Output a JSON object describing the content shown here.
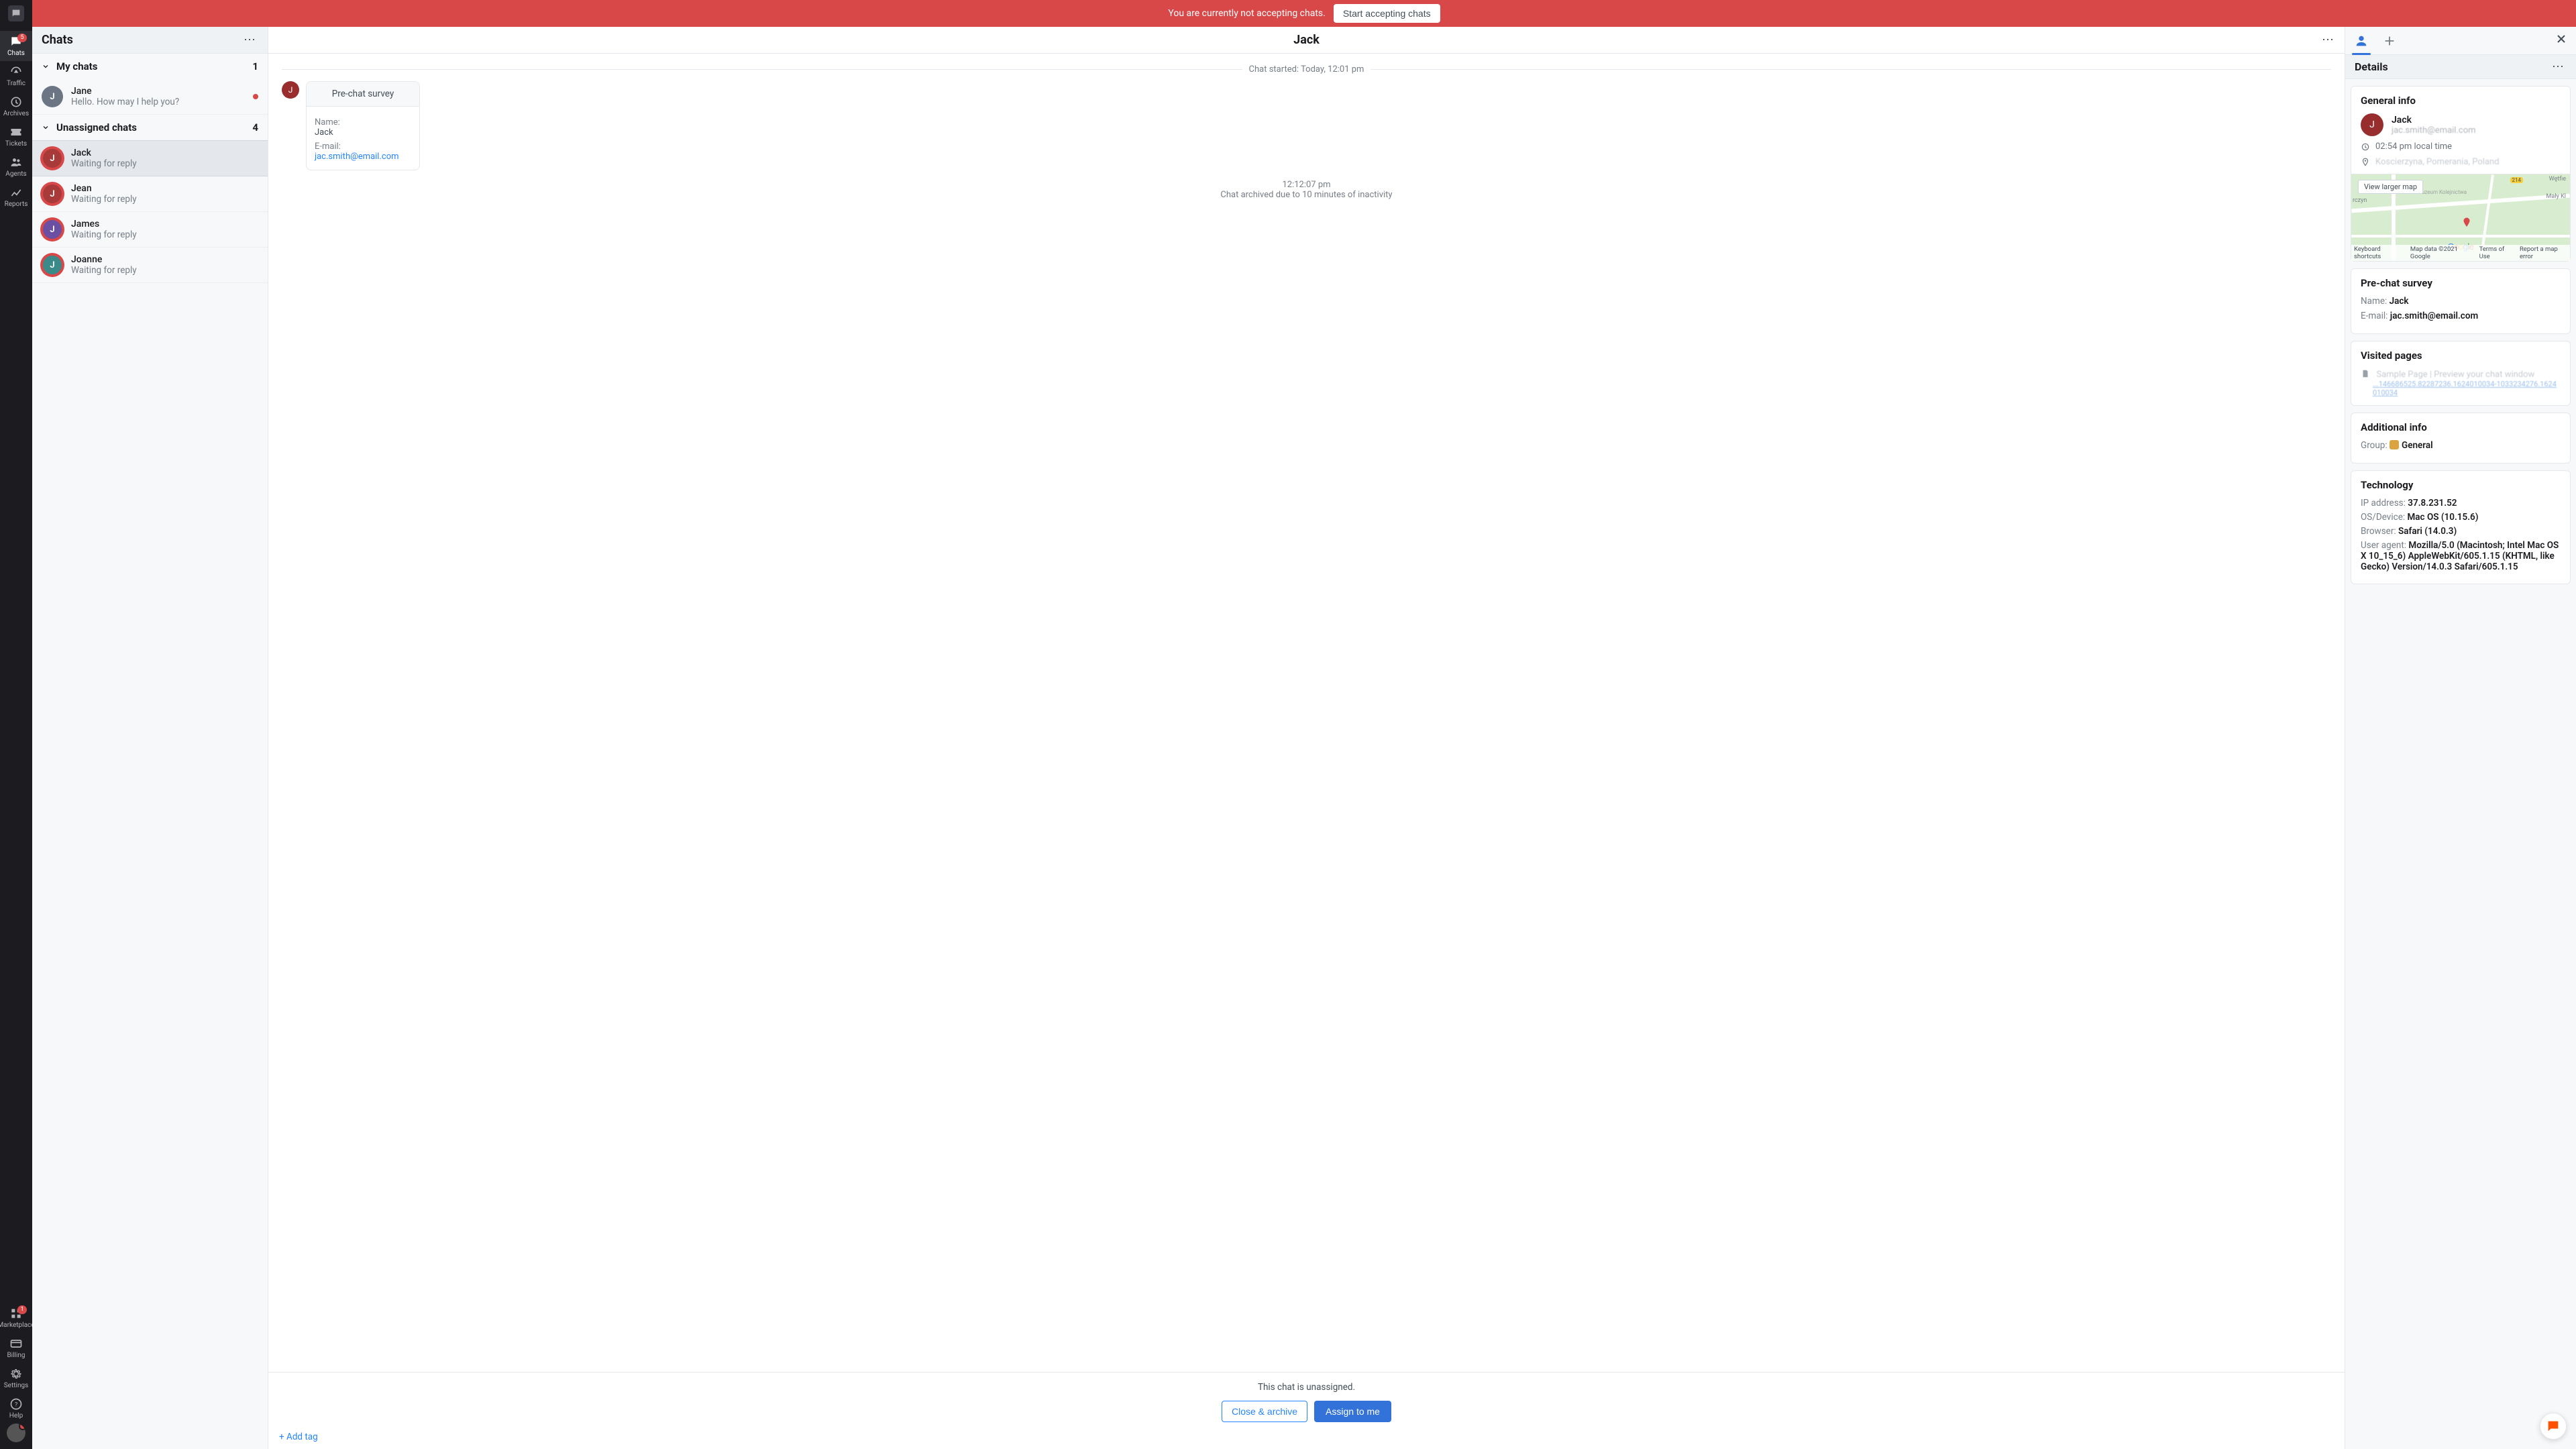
{
  "banner": {
    "message": "You are currently not accepting chats.",
    "button": "Start accepting chats"
  },
  "vnav": {
    "chats": {
      "label": "Chats",
      "badge": "5"
    },
    "traffic": {
      "label": "Traffic"
    },
    "archives": {
      "label": "Archives"
    },
    "tickets": {
      "label": "Tickets"
    },
    "agents": {
      "label": "Agents"
    },
    "reports": {
      "label": "Reports"
    },
    "marketplace": {
      "label": "Marketplace",
      "badge": "1"
    },
    "billing": {
      "label": "Billing"
    },
    "settings": {
      "label": "Settings"
    },
    "help": {
      "label": "Help"
    }
  },
  "chats": {
    "header": "Chats",
    "groups": {
      "my": {
        "title": "My chats",
        "count": "1"
      },
      "un": {
        "title": "Unassigned chats",
        "count": "4"
      }
    },
    "items": [
      {
        "initial": "J",
        "name": "Jane",
        "sub": "Hello. How may I help you?",
        "avClass": "col-a",
        "my": true,
        "dot": true
      },
      {
        "initial": "J",
        "name": "Jack",
        "sub": "Waiting for reply",
        "avClass": "col-b",
        "active": true
      },
      {
        "initial": "J",
        "name": "Jean",
        "sub": "Waiting for reply",
        "avClass": "col-b"
      },
      {
        "initial": "J",
        "name": "James",
        "sub": "Waiting for reply",
        "avClass": "col-c"
      },
      {
        "initial": "J",
        "name": "Joanne",
        "sub": "Waiting for reply",
        "avClass": "col-d"
      }
    ]
  },
  "main": {
    "title": "Jack",
    "start_divider": "Chat started: Today, 12:01 pm",
    "survey": {
      "title": "Pre-chat survey",
      "name_label": "Name:",
      "name_value": "Jack",
      "email_label": "E-mail:",
      "email_value": "jac.smith@email.com"
    },
    "ts": "12:12:07 pm",
    "archived_note": "Chat archived due to 10 minutes of inactivity",
    "footer_note": "This chat is unassigned.",
    "btn_close": "Close & archive",
    "btn_assign": "Assign to me",
    "add_tag": "+ Add tag"
  },
  "details": {
    "header": "Details",
    "general": {
      "title": "General info",
      "name": "Jack",
      "email": "jac.smith@email.com",
      "time": "02:54 pm local time",
      "location": "Koscierzyna, Pomerania, Poland",
      "view_larger": "View larger map",
      "map_footer": {
        "ks": "Keyboard shortcuts",
        "md": "Map data ©2021 Google",
        "tou": "Terms of Use",
        "rep": "Report a map error"
      }
    },
    "prechat": {
      "title": "Pre-chat survey",
      "name_label": "Name:",
      "name_value": "Jack",
      "email_label": "E-mail:",
      "email_value": "jac.smith@email.com"
    },
    "visited": {
      "title": "Visited pages",
      "line1": "Sample Page | Preview your chat window",
      "line2": "...146686525.82287236.1624010034-1033234276.1624010034"
    },
    "additional": {
      "title": "Additional info",
      "group_label": "Group:",
      "group_value": "General"
    },
    "tech": {
      "title": "Technology",
      "ip_label": "IP address:",
      "ip_value": "37.8.231.52",
      "os_label": "OS/Device:",
      "os_value": "Mac OS (10.15.6)",
      "br_label": "Browser:",
      "br_value": "Safari (14.0.3)",
      "ua_label": "User agent:",
      "ua_value": "Mozilla/5.0 (Macintosh; Intel Mac OS X 10_15_6) AppleWebKit/605.1.15 (KHTML, like Gecko) Version/14.0.3 Safari/605.1.15"
    }
  }
}
